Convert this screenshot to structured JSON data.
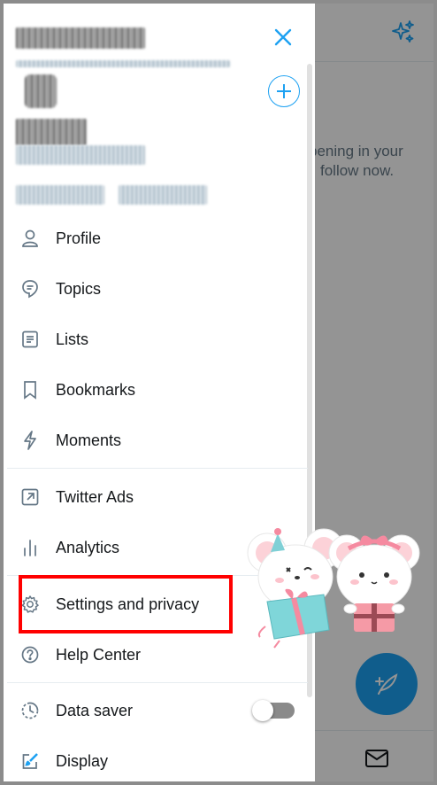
{
  "menu": [
    {
      "key": "profile",
      "label": "Profile",
      "icon": "profile-icon"
    },
    {
      "key": "topics",
      "label": "Topics",
      "icon": "topics-icon"
    },
    {
      "key": "lists",
      "label": "Lists",
      "icon": "lists-icon"
    },
    {
      "key": "bookmarks",
      "label": "Bookmarks",
      "icon": "bookmark-icon"
    },
    {
      "key": "moments",
      "label": "Moments",
      "icon": "moments-icon"
    },
    {
      "key": "twitter_ads",
      "label": "Twitter Ads",
      "icon": "external-link-icon"
    },
    {
      "key": "analytics",
      "label": "Analytics",
      "icon": "analytics-icon"
    },
    {
      "key": "settings",
      "label": "Settings and privacy",
      "icon": "gear-icon"
    },
    {
      "key": "help",
      "label": "Help Center",
      "icon": "help-icon"
    },
    {
      "key": "data_saver",
      "label": "Data saver",
      "icon": "data-saver-icon"
    },
    {
      "key": "display",
      "label": "Display",
      "icon": "display-icon"
    }
  ],
  "data_saver": {
    "enabled": false
  },
  "background": {
    "headline": "!",
    "line1": "pening in your",
    "line2": "follow now."
  },
  "colors": {
    "accent": "#1da1f2",
    "highlight_box": "#ff0000",
    "text": "#14171a",
    "secondary_text": "#657786"
  }
}
